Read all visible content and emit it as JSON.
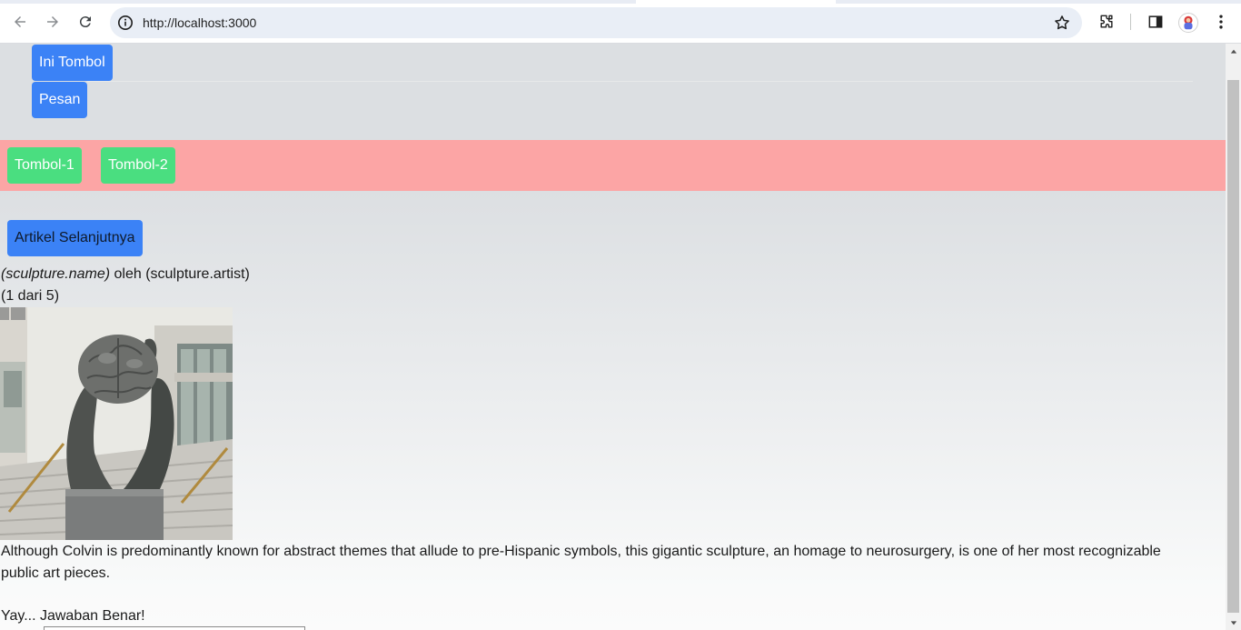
{
  "browser": {
    "url": "http://localhost:3000",
    "icons": {
      "back": "arrow-left-icon",
      "forward": "arrow-right-icon",
      "reload": "reload-icon",
      "site_info": "info-icon",
      "bookmark": "star-icon",
      "extensions": "puzzle-icon",
      "side_panel": "side-panel-icon",
      "profile": "avatar",
      "menu": "kebab-menu-icon"
    }
  },
  "header": {
    "buttons": [
      {
        "label": "Ini Tombol"
      },
      {
        "label": "Pesan"
      }
    ]
  },
  "toolbar": {
    "buttons": [
      {
        "label": "Tombol-1"
      },
      {
        "label": "Tombol-2"
      }
    ],
    "band_color": "#fca5a5"
  },
  "gallery": {
    "next_button": "Artikel Selanjutnya",
    "title_name": "(sculpture.name)",
    "title_by": " oleh ",
    "title_artist": "(sculpture.artist)",
    "counter": "(1 dari 5)",
    "image_alt": "sculpture of hands holding a brain",
    "description": "Although Colvin is predominantly known for abstract themes that allude to pre-Hispanic symbols, this gigantic sculpture, an homage to neurosurgery, is one of her most recognizable public art pieces.",
    "status": "Yay... Jawaban Benar!"
  },
  "colors": {
    "primary_button": "#3b82f6",
    "success_button": "#4ade80"
  }
}
